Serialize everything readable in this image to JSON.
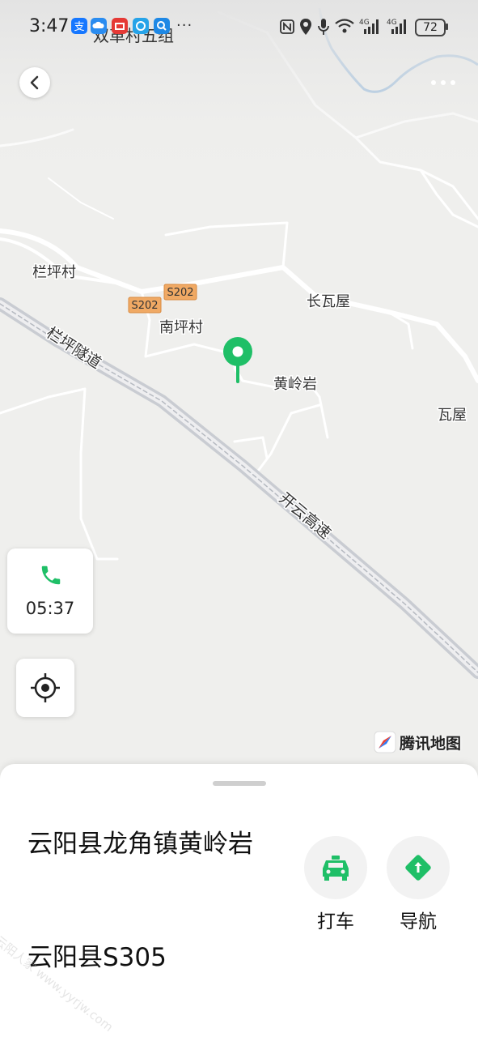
{
  "status_bar": {
    "time": "3:47",
    "overflow": "···",
    "battery": "72",
    "overlap_text": "双革村五组",
    "icons": [
      "alipay-icon",
      "cloud-icon",
      "wallet-icon",
      "app-icon",
      "search-icon",
      "nfc-icon",
      "location-icon",
      "mic-icon",
      "wifi-icon",
      "signal-4g-icon",
      "signal-4g-icon"
    ]
  },
  "map": {
    "labels": {
      "lanping_village": "栏坪村",
      "s202_a": "S202",
      "s202_b": "S202",
      "nanping_village": "南坪村",
      "changwawu": "长瓦屋",
      "huanglingyan": "黄岭岩",
      "wawu": "瓦屋",
      "tunnel": "栏坪隧道",
      "expressway": "开云高速"
    },
    "brand": "腾讯地图",
    "colors": {
      "road": "#ffffff",
      "river": "#8fb6dc",
      "highway": "#c9ccd2",
      "pin": "#1fbf67",
      "shield": "#f0a964"
    }
  },
  "call_card": {
    "duration": "05:37",
    "icon": "phone-icon"
  },
  "sheet": {
    "title": "云阳县龙角镇黄岭岩",
    "subtitle": "云阳县S305",
    "actions": [
      {
        "label": "打车",
        "icon": "taxi-icon"
      },
      {
        "label": "导航",
        "icon": "navigation-icon"
      }
    ]
  },
  "watermark": "云阳人家 www.yyrjw.com"
}
